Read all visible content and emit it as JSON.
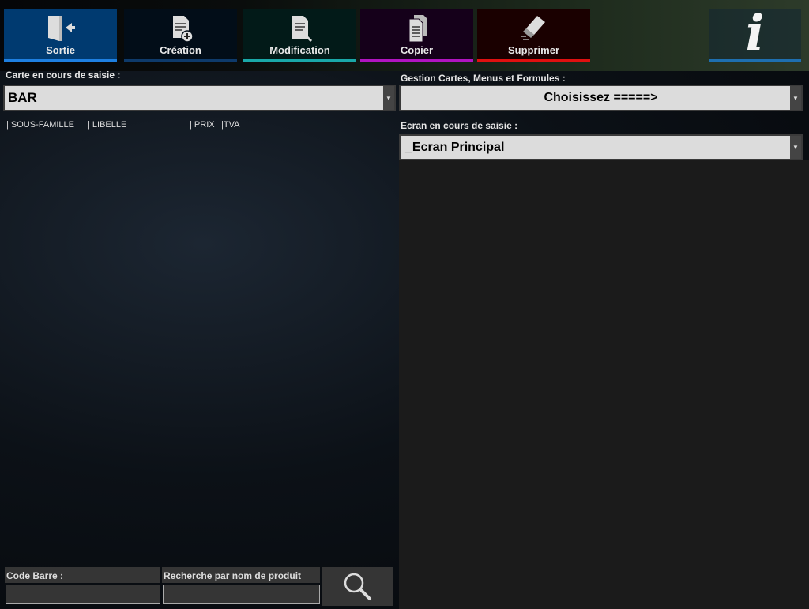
{
  "toolbar": {
    "buttons": [
      {
        "label": "Sortie",
        "icon": "exit-door-icon",
        "bg": "#003a70",
        "line": "#1e7fe0"
      },
      {
        "label": "Création",
        "icon": "new-document-icon",
        "bg": "#020d18",
        "line": "#0e3a6a"
      },
      {
        "label": "Modification",
        "icon": "edit-document-icon",
        "bg": "#021a18",
        "line": "#1aa8a8"
      },
      {
        "label": "Copier",
        "icon": "copy-documents-icon",
        "bg": "#15001a",
        "line": "#b014c0"
      },
      {
        "label": "Supprimer",
        "icon": "eraser-icon",
        "bg": "#1a0000",
        "line": "#e01010"
      }
    ],
    "info_icon": "info-icon"
  },
  "left": {
    "carte_label": "Carte en cours de saisie :",
    "carte_value": "BAR",
    "columns": [
      "| SOUS-FAMILLE",
      "| LIBELLE",
      "| PRIX",
      "|TVA"
    ],
    "code_barre_label": "Code Barre :",
    "code_barre_value": "",
    "recherche_label": "Recherche par nom de produit",
    "recherche_value": "",
    "search_icon": "magnifier-icon"
  },
  "right": {
    "gestion_label": "Gestion Cartes, Menus et Formules  :",
    "gestion_value": "Choisissez  =====>",
    "ecran_label": "Ecran en cours de saisie :",
    "ecran_value": "_Ecran Principal"
  }
}
